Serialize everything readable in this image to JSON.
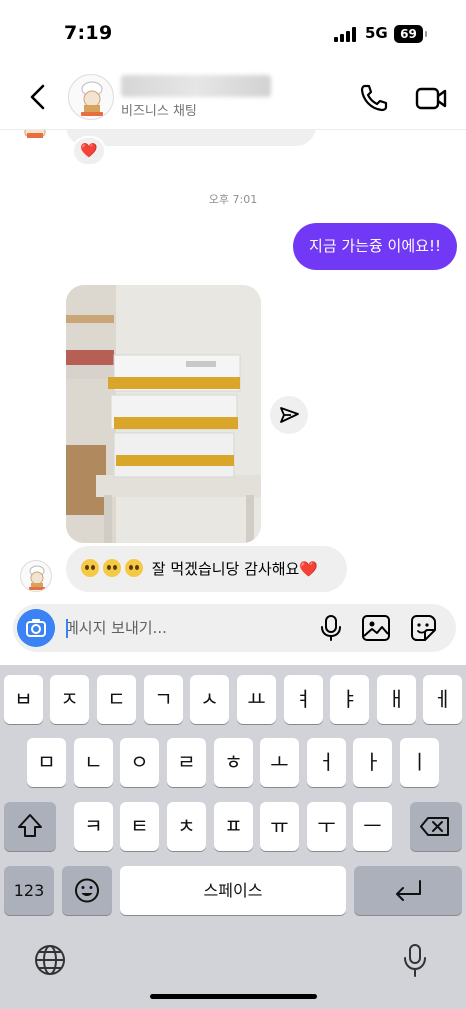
{
  "status_bar": {
    "time": "7:19",
    "network": "5G",
    "battery": "69"
  },
  "header": {
    "subtitle": "비즈니스 채팅"
  },
  "chat": {
    "reaction": "❤️",
    "timestamp": "오후 7:01",
    "outgoing_message": "지금 가는즁 이에요!!",
    "incoming_message": "잘 먹겠습니당 감사해요",
    "incoming_heart": "❤️"
  },
  "composer": {
    "placeholder": "메시지 보내기..."
  },
  "keyboard": {
    "row1": [
      "ㅂ",
      "ㅈ",
      "ㄷ",
      "ㄱ",
      "ㅅ",
      "ㅛ",
      "ㅕ",
      "ㅑ",
      "ㅐ",
      "ㅔ"
    ],
    "row2": [
      "ㅁ",
      "ㄴ",
      "ㅇ",
      "ㄹ",
      "ㅎ",
      "ㅗ",
      "ㅓ",
      "ㅏ",
      "ㅣ"
    ],
    "row3": [
      "ㅋ",
      "ㅌ",
      "ㅊ",
      "ㅍ",
      "ㅠ",
      "ㅜ",
      "ㅡ"
    ],
    "numbers_key": "123",
    "space_key": "스페이스"
  },
  "colors": {
    "accent": "#7138f5",
    "camera": "#3b82f6",
    "keyboard_bg": "#d1d3d9",
    "bubble_in": "#efefef"
  }
}
